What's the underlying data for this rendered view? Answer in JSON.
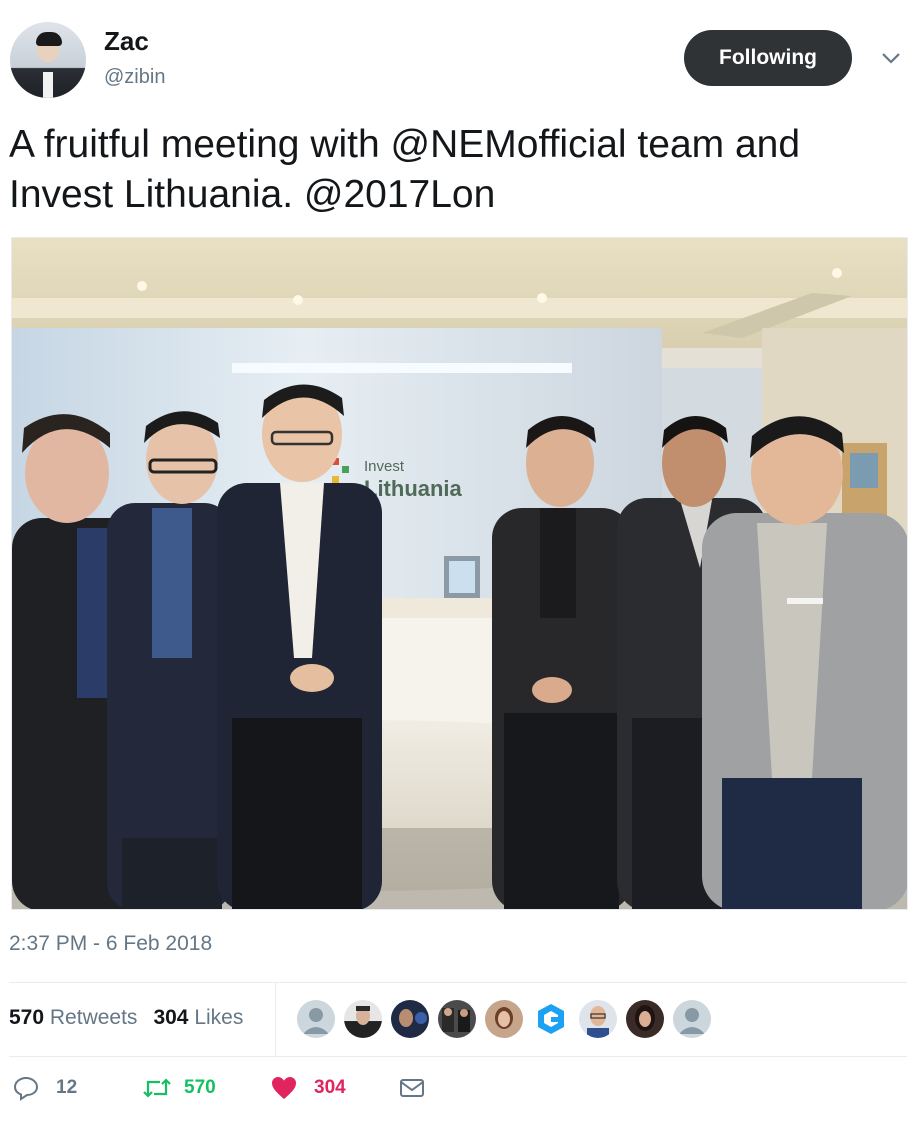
{
  "user": {
    "name": "Zac",
    "handle": "@zibin",
    "follow_label": "Following"
  },
  "tweet": {
    "text": "A fruitful meeting with @NEMofficial team and Invest Lithuania. @2017Lon",
    "photo_sign": [
      "Invest",
      "Lithuania"
    ],
    "timestamp": "2:37 PM - 6 Feb 2018"
  },
  "stats": {
    "retweets_count": "570",
    "retweets_label": "Retweets",
    "likes_count": "304",
    "likes_label": "Likes"
  },
  "likers": [
    {
      "icon": "default-avatar-icon"
    },
    {
      "icon": "user-avatar"
    },
    {
      "icon": "user-avatar"
    },
    {
      "icon": "user-avatar"
    },
    {
      "icon": "user-avatar"
    },
    {
      "icon": "brand-logo-icon"
    },
    {
      "icon": "user-avatar"
    },
    {
      "icon": "user-avatar"
    },
    {
      "icon": "default-avatar-icon"
    }
  ],
  "actions": {
    "reply_count": "12",
    "retweet_count": "570",
    "like_count": "304"
  },
  "colors": {
    "follow_button_bg": "#2f3336",
    "retweet_green": "#17bf63",
    "like_red": "#e0245e",
    "muted_text": "#657786"
  }
}
